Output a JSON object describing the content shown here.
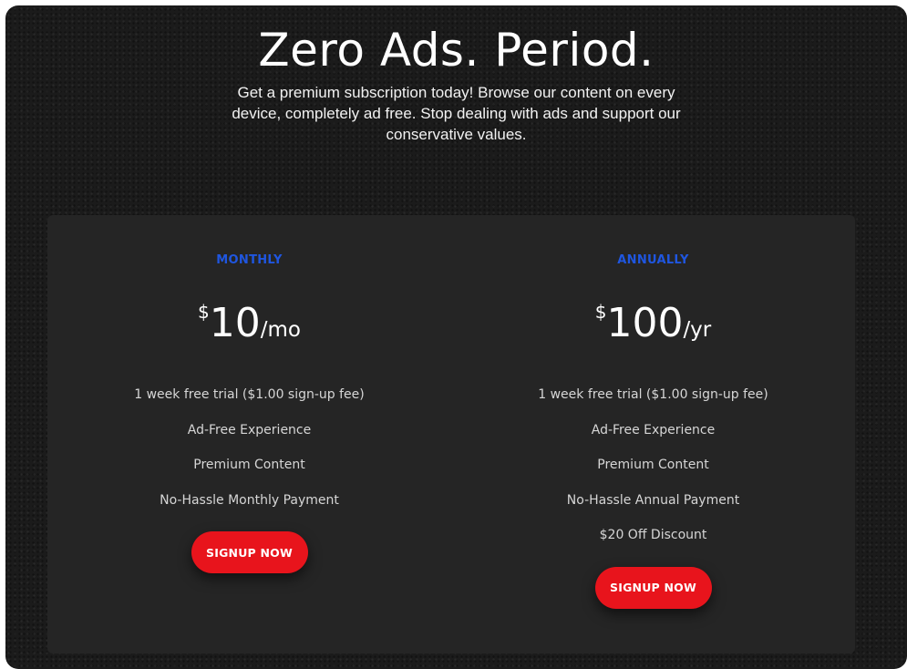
{
  "hero": {
    "title": "Zero Ads. Period.",
    "subtitle": "Get a premium subscription today! Browse our content on every device, completely ad free. Stop dealing with ads and support our conservative values."
  },
  "plans": [
    {
      "name": "MONTHLY",
      "currency": "$",
      "amount": "10",
      "period": "/mo",
      "features": [
        "1 week free trial ($1.00 sign-up fee)",
        "Ad-Free Experience",
        "Premium Content",
        "No-Hassle Monthly Payment"
      ],
      "button_label": "SIGNUP NOW"
    },
    {
      "name": "ANNUALLY",
      "currency": "$",
      "amount": "100",
      "period": "/yr",
      "features": [
        "1 week free trial ($1.00 sign-up fee)",
        "Ad-Free Experience",
        "Premium Content",
        "No-Hassle Annual Payment",
        "$20 Off Discount"
      ],
      "button_label": "SIGNUP NOW"
    }
  ],
  "colors": {
    "background": "#1b1b1b",
    "card": "#252525",
    "plan_name": "#1f56e0",
    "button": "#e8141c"
  }
}
